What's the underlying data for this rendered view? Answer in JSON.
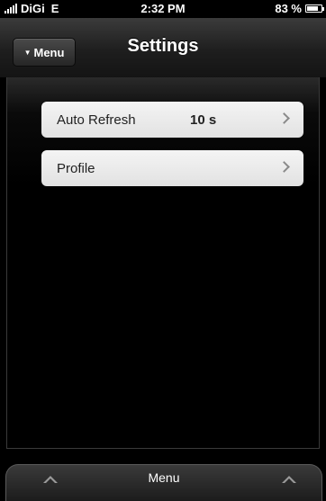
{
  "status_bar": {
    "carrier": "DiGi",
    "network": "E",
    "time": "2:32 PM",
    "battery": "83 %",
    "battery_level": 0.83
  },
  "nav": {
    "menu_label": "Menu",
    "title": "Settings"
  },
  "settings": {
    "items": [
      {
        "label": "Auto Refresh",
        "value": "10 s"
      },
      {
        "label": "Profile",
        "value": ""
      }
    ]
  },
  "bottom_tab": {
    "label": "Menu"
  },
  "colors": {
    "background": "#000000",
    "cell": "#eeeeee",
    "text": "#ffffff"
  }
}
